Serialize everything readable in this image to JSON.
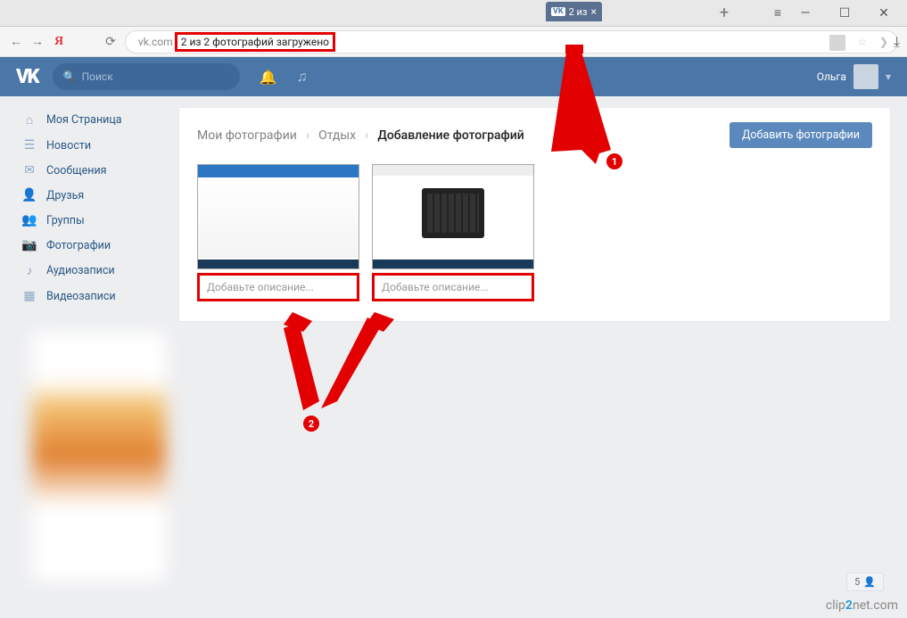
{
  "browser": {
    "tab_title": "2 из",
    "url_host": "vk.com",
    "url_status": "2 из 2 фотографий загружено"
  },
  "header": {
    "search_placeholder": "Поиск",
    "username": "Ольга"
  },
  "sidebar": {
    "items": [
      {
        "icon": "home",
        "label": "Моя Страница"
      },
      {
        "icon": "news",
        "label": "Новости"
      },
      {
        "icon": "msg",
        "label": "Сообщения"
      },
      {
        "icon": "friends",
        "label": "Друзья"
      },
      {
        "icon": "groups",
        "label": "Группы"
      },
      {
        "icon": "photos",
        "label": "Фотографии"
      },
      {
        "icon": "audio",
        "label": "Аудиозаписи"
      },
      {
        "icon": "video",
        "label": "Видеозаписи"
      }
    ]
  },
  "breadcrumb": {
    "root": "Мои фотографии",
    "album": "Отдых",
    "current": "Добавление фотографий"
  },
  "buttons": {
    "add_photos": "Добавить фотографии"
  },
  "thumbs": {
    "desc_placeholder": "Добавьте описание..."
  },
  "annotations": {
    "n1": "1",
    "n2": "2"
  },
  "counter": {
    "value": "5"
  },
  "watermark": {
    "pre": "clip",
    "mid": "2",
    "post": "net.com"
  }
}
